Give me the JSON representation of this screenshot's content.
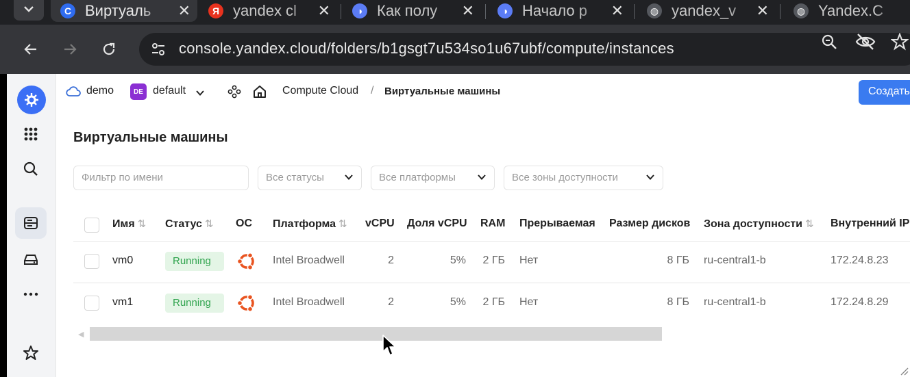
{
  "browser": {
    "tabs": [
      {
        "title": "Виртуаль",
        "favicon": "yandex-cloud-icon",
        "active": true
      },
      {
        "title": "yandex cl",
        "favicon": "yandex-y-icon",
        "active": false
      },
      {
        "title": "Как полу",
        "favicon": "alice-icon",
        "active": false
      },
      {
        "title": "Начало р",
        "favicon": "alice-icon",
        "active": false
      },
      {
        "title": "yandex_v",
        "favicon": "globe-icon",
        "active": false
      },
      {
        "title": "Yandex.C",
        "favicon": "globe-icon",
        "active": false
      }
    ],
    "url": "console.yandex.cloud/folders/b1gsgt7u534so1u67ubf/compute/instances"
  },
  "header": {
    "cloud": "demo",
    "folder_badge": "DE",
    "folder": "default",
    "service": "Compute Cloud",
    "separator": "/",
    "current": "Виртуальные машины",
    "create_button": "Создать"
  },
  "page": {
    "title": "Виртуальные машины"
  },
  "filters": {
    "name_placeholder": "Фильтр по имени",
    "status": "Все статусы",
    "platform": "Все платформы",
    "zone": "Все зоны доступности"
  },
  "table": {
    "columns": {
      "name": "Имя",
      "status": "Статус",
      "os": "ОС",
      "platform": "Платформа",
      "vcpu": "vCPU",
      "vcpu_share": "Доля vCPU",
      "ram": "RAM",
      "preemptible": "Прерываемая",
      "disk_size": "Размер дисков",
      "zone": "Зона доступности",
      "internal_ip": "Внутренний IP"
    },
    "sort_glyph": "⇅",
    "rows": [
      {
        "name": "vm0",
        "status": "Running",
        "os": "ubuntu-icon",
        "platform": "Intel Broadwell",
        "vcpu": "2",
        "vcpu_share": "5%",
        "ram": "2 ГБ",
        "preemptible": "Нет",
        "disk_size": "8 ГБ",
        "zone": "ru-central1-b",
        "internal_ip": "172.24.8.23"
      },
      {
        "name": "vm1",
        "status": "Running",
        "os": "ubuntu-icon",
        "platform": "Intel Broadwell",
        "vcpu": "2",
        "vcpu_share": "5%",
        "ram": "2 ГБ",
        "preemptible": "Нет",
        "disk_size": "8 ГБ",
        "zone": "ru-central1-b",
        "internal_ip": "172.24.8.29"
      }
    ]
  },
  "colors": {
    "accent": "#3a7bf0",
    "running_bg": "#e4f5e6",
    "running_text": "#2fa34d",
    "ubuntu": "#e95420",
    "folder_badge": "#8b2fd3"
  }
}
